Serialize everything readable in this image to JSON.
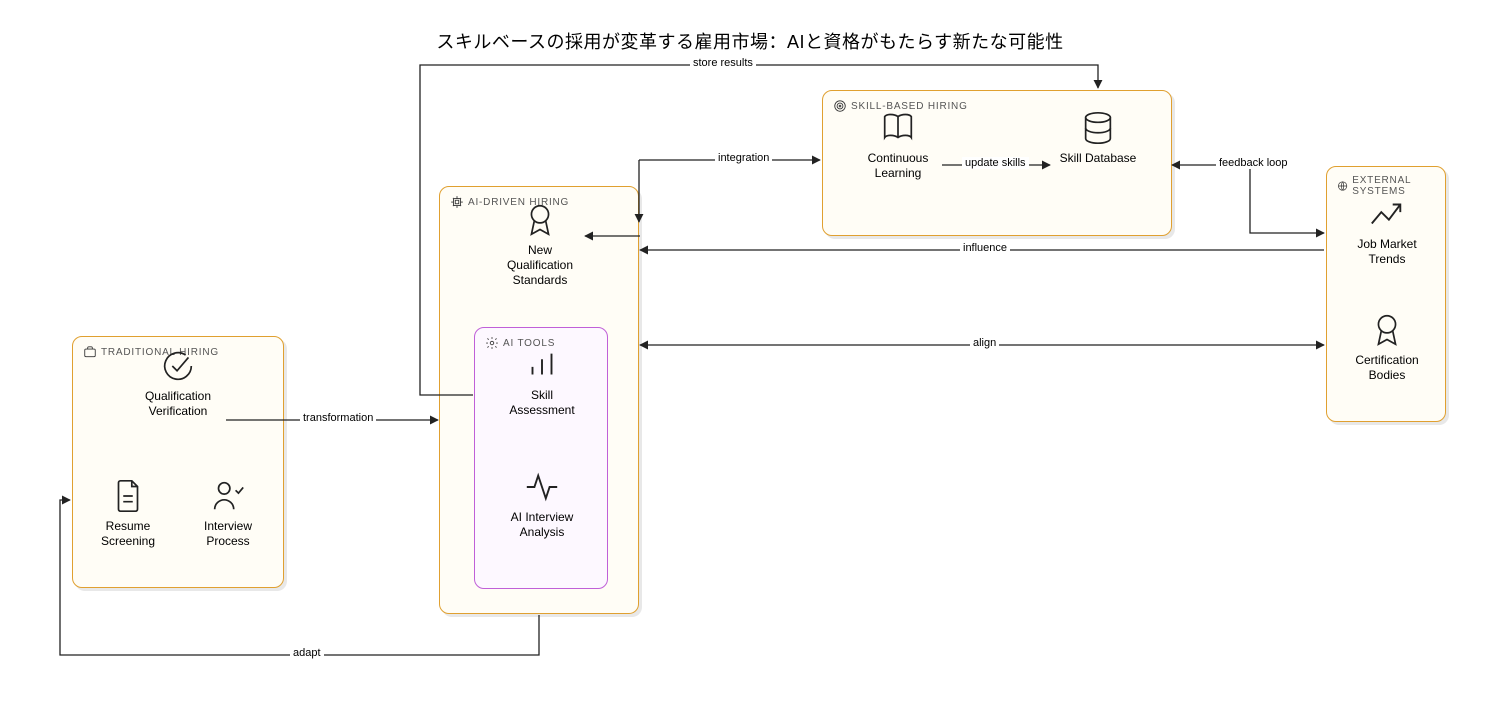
{
  "title": "スキルベースの採用が変革する雇用市場：AIと資格がもたらす新たな可能性",
  "groups": {
    "traditional": {
      "label": "TRADITIONAL HIRING"
    },
    "aidriven": {
      "label": "AI-DRIVEN HIRING"
    },
    "aitools": {
      "label": "AI TOOLS"
    },
    "skillbased": {
      "label": "SKILL-BASED HIRING"
    },
    "external": {
      "label": "EXTERNAL SYSTEMS"
    }
  },
  "nodes": {
    "qualverify": "Qualification Verification",
    "resume": "Resume Screening",
    "interview": "Interview Process",
    "newqual": "New Qualification Standards",
    "skillassess": "Skill Assessment",
    "aiinterview": "AI Interview Analysis",
    "contlearn": "Continuous Learning",
    "skilldb": "Skill Database",
    "trends": "Job Market Trends",
    "certbodies": "Certification Bodies"
  },
  "edges": {
    "transformation": "transformation",
    "integration": "integration",
    "updateskills": "update skills",
    "storeresults": "store results",
    "feedback": "feedback loop",
    "influence": "influence",
    "align": "align",
    "adapt": "adapt"
  }
}
